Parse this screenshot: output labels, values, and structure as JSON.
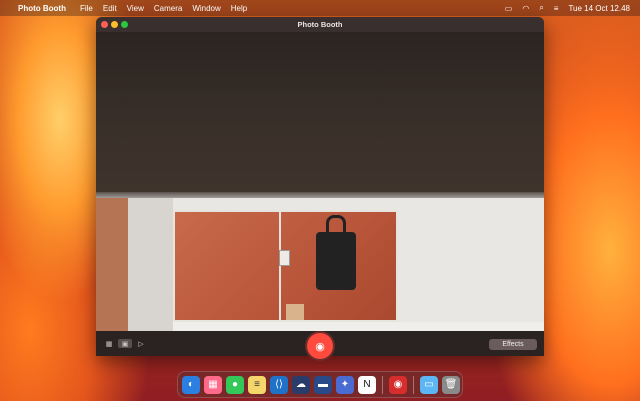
{
  "menubar": {
    "apple_icon": "apple-icon",
    "app_name": "Photo Booth",
    "items": [
      "File",
      "Edit",
      "View",
      "Camera",
      "Window",
      "Help"
    ],
    "datetime": "Tue 14 Oct 12.48",
    "status_icons": [
      "battery-icon",
      "wifi-icon",
      "search-icon",
      "control-center-icon"
    ]
  },
  "window": {
    "title": "Photo Booth"
  },
  "controls": {
    "effects_label": "Effects",
    "shutter_icon": "camera-icon",
    "view_modes": [
      "grid-icon",
      "single-photo-icon",
      "video-icon"
    ]
  },
  "dock": {
    "apps": [
      {
        "name": "finder",
        "color": "#2a7fe0"
      },
      {
        "name": "launchpad",
        "color": "#ff6a8a"
      },
      {
        "name": "messages",
        "color": "#34c759"
      },
      {
        "name": "notes",
        "color": "#f5d66b"
      },
      {
        "name": "vscode",
        "color": "#1e73c9"
      },
      {
        "name": "bluesky",
        "color": "#2a3c6a"
      },
      {
        "name": "keynote",
        "color": "#284a88"
      },
      {
        "name": "pinterest-app",
        "color": "#4a6bd1"
      },
      {
        "name": "notion",
        "color": "#ffffff"
      },
      {
        "name": "photo-booth",
        "color": "#d62d2d"
      },
      {
        "name": "folder",
        "color": "#5bb6f3"
      },
      {
        "name": "trash",
        "color": "#8a8a8a"
      }
    ]
  }
}
